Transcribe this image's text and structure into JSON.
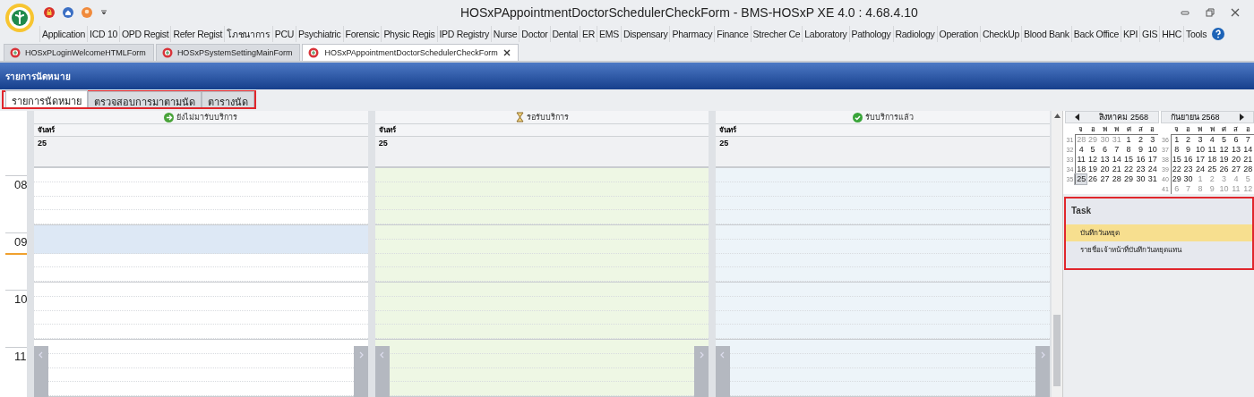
{
  "window": {
    "title": "HOSxPAppointmentDoctorSchedulerCheckForm - BMS-HOSxP XE 4.0 : 4.68.4.10"
  },
  "ribbon_tabs": [
    "Application",
    "ICD 10",
    "OPD Regist",
    "Refer Regist",
    "โภชนาการ",
    "PCU",
    "Psychiatric",
    "Forensic",
    "Physic Regis",
    "IPD Registry",
    "Nurse",
    "Doctor",
    "Dental",
    "ER",
    "EMS",
    "Dispensary",
    "Pharmacy",
    "Finance",
    "Strecher Ce",
    "Laboratory",
    "Pathology",
    "Radiology",
    "Operation",
    "CheckUp",
    "Blood Bank",
    "Back Office",
    "KPI",
    "GIS",
    "HHC",
    "Tools"
  ],
  "doc_tabs": [
    {
      "label": "HOSxPLoginWelcomeHTMLForm",
      "selected": false
    },
    {
      "label": "HOSxPSystemSettingMainForm",
      "selected": false
    },
    {
      "label": "HOSxPAppointmentDoctorSchedulerCheckForm",
      "selected": true
    }
  ],
  "panel_title": "รายการนัดหมาย",
  "view_tabs": [
    {
      "label": "รายการนัดหมาย",
      "selected": true
    },
    {
      "label": "ตรวจสอบการมาตามนัด",
      "selected": false
    },
    {
      "label": "ตารางนัด",
      "selected": false
    }
  ],
  "scheduler": {
    "hours": [
      {
        "label": "08",
        "current": false
      },
      {
        "label": "09",
        "current": true
      },
      {
        "label": "10",
        "current": false
      },
      {
        "label": "11",
        "current": false
      }
    ],
    "columns": [
      {
        "kind": "not-arrived",
        "status": "ยังไม่มารับบริการ",
        "day": "จันทร์",
        "date": "25",
        "color": "#ffffff"
      },
      {
        "kind": "waiting",
        "status": "รอรับบริการ",
        "day": "จันทร์",
        "date": "25",
        "color": "#eef7e4"
      },
      {
        "kind": "done",
        "status": "รับบริการแล้ว",
        "day": "จันทร์",
        "date": "25",
        "color": "#edf4f9"
      }
    ]
  },
  "calendar": {
    "months": [
      {
        "title": "สิงหาคม 2568",
        "weekdays": [
          "จ",
          "อ",
          "พ",
          "พ",
          "ศ",
          "ส",
          "อ"
        ],
        "weeks": [
          {
            "number": "31",
            "days": [
              {
                "d": "28",
                "muted": true,
                "selected": false
              },
              {
                "d": "29",
                "muted": true,
                "selected": false
              },
              {
                "d": "30",
                "muted": true,
                "selected": false
              },
              {
                "d": "31",
                "muted": true,
                "selected": false
              },
              {
                "d": "1",
                "muted": false,
                "selected": false
              },
              {
                "d": "2",
                "muted": false,
                "selected": false
              },
              {
                "d": "3",
                "muted": false,
                "selected": false
              }
            ]
          },
          {
            "number": "32",
            "days": [
              {
                "d": "4",
                "muted": false,
                "selected": false
              },
              {
                "d": "5",
                "muted": false,
                "selected": false
              },
              {
                "d": "6",
                "muted": false,
                "selected": false
              },
              {
                "d": "7",
                "muted": false,
                "selected": false
              },
              {
                "d": "8",
                "muted": false,
                "selected": false
              },
              {
                "d": "9",
                "muted": false,
                "selected": false
              },
              {
                "d": "10",
                "muted": false,
                "selected": false
              }
            ]
          },
          {
            "number": "33",
            "days": [
              {
                "d": "11",
                "muted": false,
                "selected": false
              },
              {
                "d": "12",
                "muted": false,
                "selected": false
              },
              {
                "d": "13",
                "muted": false,
                "selected": false
              },
              {
                "d": "14",
                "muted": false,
                "selected": false
              },
              {
                "d": "15",
                "muted": false,
                "selected": false
              },
              {
                "d": "16",
                "muted": false,
                "selected": false
              },
              {
                "d": "17",
                "muted": false,
                "selected": false
              }
            ]
          },
          {
            "number": "34",
            "days": [
              {
                "d": "18",
                "muted": false,
                "selected": false
              },
              {
                "d": "19",
                "muted": false,
                "selected": false
              },
              {
                "d": "20",
                "muted": false,
                "selected": false
              },
              {
                "d": "21",
                "muted": false,
                "selected": false
              },
              {
                "d": "22",
                "muted": false,
                "selected": false
              },
              {
                "d": "23",
                "muted": false,
                "selected": false
              },
              {
                "d": "24",
                "muted": false,
                "selected": false
              }
            ]
          },
          {
            "number": "35",
            "days": [
              {
                "d": "25",
                "muted": false,
                "selected": true
              },
              {
                "d": "26",
                "muted": false,
                "selected": false
              },
              {
                "d": "27",
                "muted": false,
                "selected": false
              },
              {
                "d": "28",
                "muted": false,
                "selected": false
              },
              {
                "d": "29",
                "muted": false,
                "selected": false
              },
              {
                "d": "30",
                "muted": false,
                "selected": false
              },
              {
                "d": "31",
                "muted": false,
                "selected": false
              }
            ]
          }
        ]
      },
      {
        "title": "กันยายน 2568",
        "weekdays": [
          "จ",
          "อ",
          "พ",
          "พ",
          "ศ",
          "ส",
          "อ"
        ],
        "weeks": [
          {
            "number": "36",
            "days": [
              {
                "d": "1",
                "muted": false,
                "selected": false
              },
              {
                "d": "2",
                "muted": false,
                "selected": false
              },
              {
                "d": "3",
                "muted": false,
                "selected": false
              },
              {
                "d": "4",
                "muted": false,
                "selected": false
              },
              {
                "d": "5",
                "muted": false,
                "selected": false
              },
              {
                "d": "6",
                "muted": false,
                "selected": false
              },
              {
                "d": "7",
                "muted": false,
                "selected": false
              }
            ]
          },
          {
            "number": "37",
            "days": [
              {
                "d": "8",
                "muted": false,
                "selected": false
              },
              {
                "d": "9",
                "muted": false,
                "selected": false
              },
              {
                "d": "10",
                "muted": false,
                "selected": false
              },
              {
                "d": "11",
                "muted": false,
                "selected": false
              },
              {
                "d": "12",
                "muted": false,
                "selected": false
              },
              {
                "d": "13",
                "muted": false,
                "selected": false
              },
              {
                "d": "14",
                "muted": false,
                "selected": false
              }
            ]
          },
          {
            "number": "38",
            "days": [
              {
                "d": "15",
                "muted": false,
                "selected": false
              },
              {
                "d": "16",
                "muted": false,
                "selected": false
              },
              {
                "d": "17",
                "muted": false,
                "selected": false
              },
              {
                "d": "18",
                "muted": false,
                "selected": false
              },
              {
                "d": "19",
                "muted": false,
                "selected": false
              },
              {
                "d": "20",
                "muted": false,
                "selected": false
              },
              {
                "d": "21",
                "muted": false,
                "selected": false
              }
            ]
          },
          {
            "number": "39",
            "days": [
              {
                "d": "22",
                "muted": false,
                "selected": false
              },
              {
                "d": "23",
                "muted": false,
                "selected": false
              },
              {
                "d": "24",
                "muted": false,
                "selected": false
              },
              {
                "d": "25",
                "muted": false,
                "selected": false
              },
              {
                "d": "26",
                "muted": false,
                "selected": false
              },
              {
                "d": "27",
                "muted": false,
                "selected": false
              },
              {
                "d": "28",
                "muted": false,
                "selected": false
              }
            ]
          },
          {
            "number": "40",
            "days": [
              {
                "d": "29",
                "muted": false,
                "selected": false
              },
              {
                "d": "30",
                "muted": false,
                "selected": false
              },
              {
                "d": "1",
                "muted": true,
                "selected": false
              },
              {
                "d": "2",
                "muted": true,
                "selected": false
              },
              {
                "d": "3",
                "muted": true,
                "selected": false
              },
              {
                "d": "4",
                "muted": true,
                "selected": false
              },
              {
                "d": "5",
                "muted": true,
                "selected": false
              }
            ]
          },
          {
            "number": "41",
            "days": [
              {
                "d": "6",
                "muted": true,
                "selected": false
              },
              {
                "d": "7",
                "muted": true,
                "selected": false
              },
              {
                "d": "8",
                "muted": true,
                "selected": false
              },
              {
                "d": "9",
                "muted": true,
                "selected": false
              },
              {
                "d": "10",
                "muted": true,
                "selected": false
              },
              {
                "d": "11",
                "muted": true,
                "selected": false
              },
              {
                "d": "12",
                "muted": true,
                "selected": false
              }
            ]
          }
        ]
      }
    ]
  },
  "task": {
    "title": "Task",
    "items": [
      {
        "label": "บันทึกวันหยุด",
        "selected": true
      },
      {
        "label": "รายชื่อเจ้าหน้าที่บันทึกวันหยุดแทน",
        "selected": false
      }
    ]
  }
}
